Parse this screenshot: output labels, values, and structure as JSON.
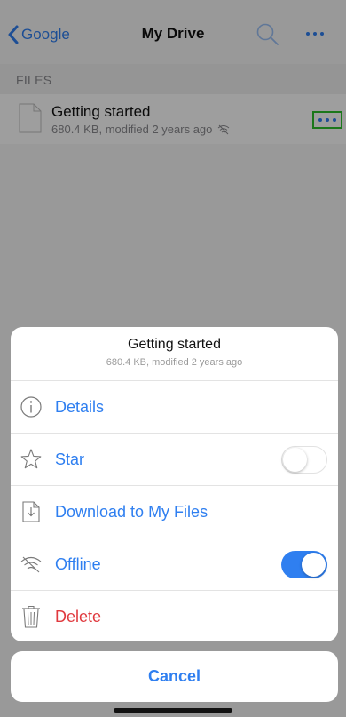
{
  "nav": {
    "back_label": "Google",
    "title": "My Drive",
    "search_icon": "search-icon",
    "more_icon": "more-icon"
  },
  "section": {
    "label": "FILES"
  },
  "file": {
    "name": "Getting started",
    "meta": "680.4 KB, modified 2 years ago",
    "offline_icon": "offline-icon"
  },
  "sheet": {
    "title": "Getting started",
    "subtitle": "680.4 KB, modified 2 years ago",
    "actions": [
      {
        "label": "Details",
        "icon": "info-icon"
      },
      {
        "label": "Star",
        "icon": "star-icon",
        "toggle": false
      },
      {
        "label": "Download to My Files",
        "icon": "download-icon"
      },
      {
        "label": "Offline",
        "icon": "offline-icon",
        "toggle": true
      },
      {
        "label": "Delete",
        "icon": "trash-icon"
      }
    ]
  },
  "cancel_label": "Cancel",
  "colors": {
    "accent": "#2f7ff0",
    "danger": "#e0393e",
    "highlight": "#2cc12c"
  }
}
